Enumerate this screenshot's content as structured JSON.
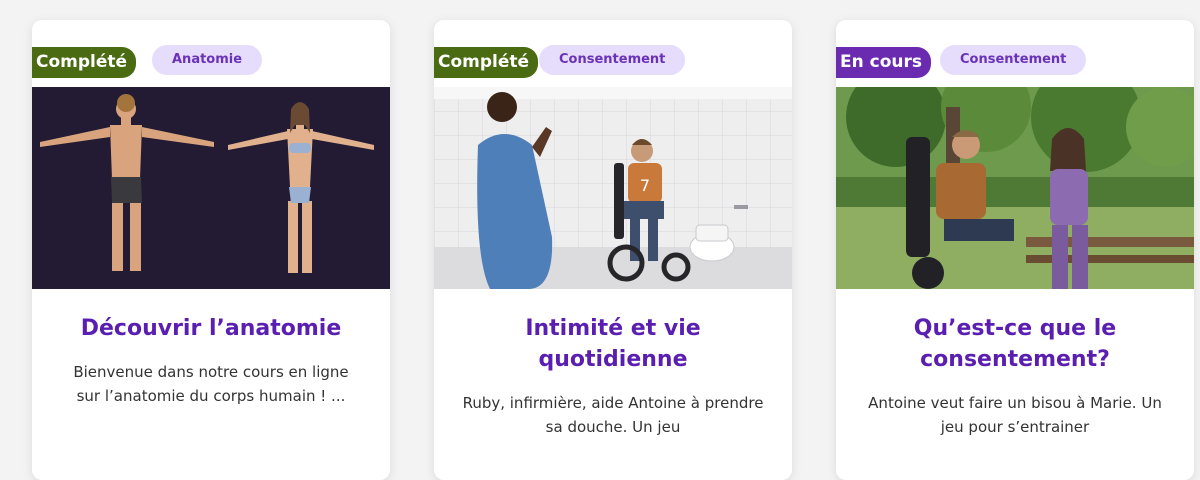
{
  "courses": [
    {
      "status": "Complété",
      "tag": "Anatomie",
      "title": "Découvrir l’anatomie",
      "description": "Bienvenue dans notre cours en ligne sur l’anatomie du corps humain ! ...",
      "colors": {
        "status": "#4a6b12"
      }
    },
    {
      "status": "Complété",
      "tag": "Consentement",
      "title": "Intimité et vie quotidienne",
      "description": "Ruby, infirmière, aide Antoine à prendre sa douche. Un jeu",
      "colors": {
        "status": "#4a6b12"
      }
    },
    {
      "status": "En cours",
      "tag": "Consentement",
      "title": "Qu’est-ce que le consentement?",
      "description": "Antoine veut faire un bisou à Marie. Un jeu pour s’entrainer",
      "colors": {
        "status": "#6a2bb0"
      }
    }
  ]
}
